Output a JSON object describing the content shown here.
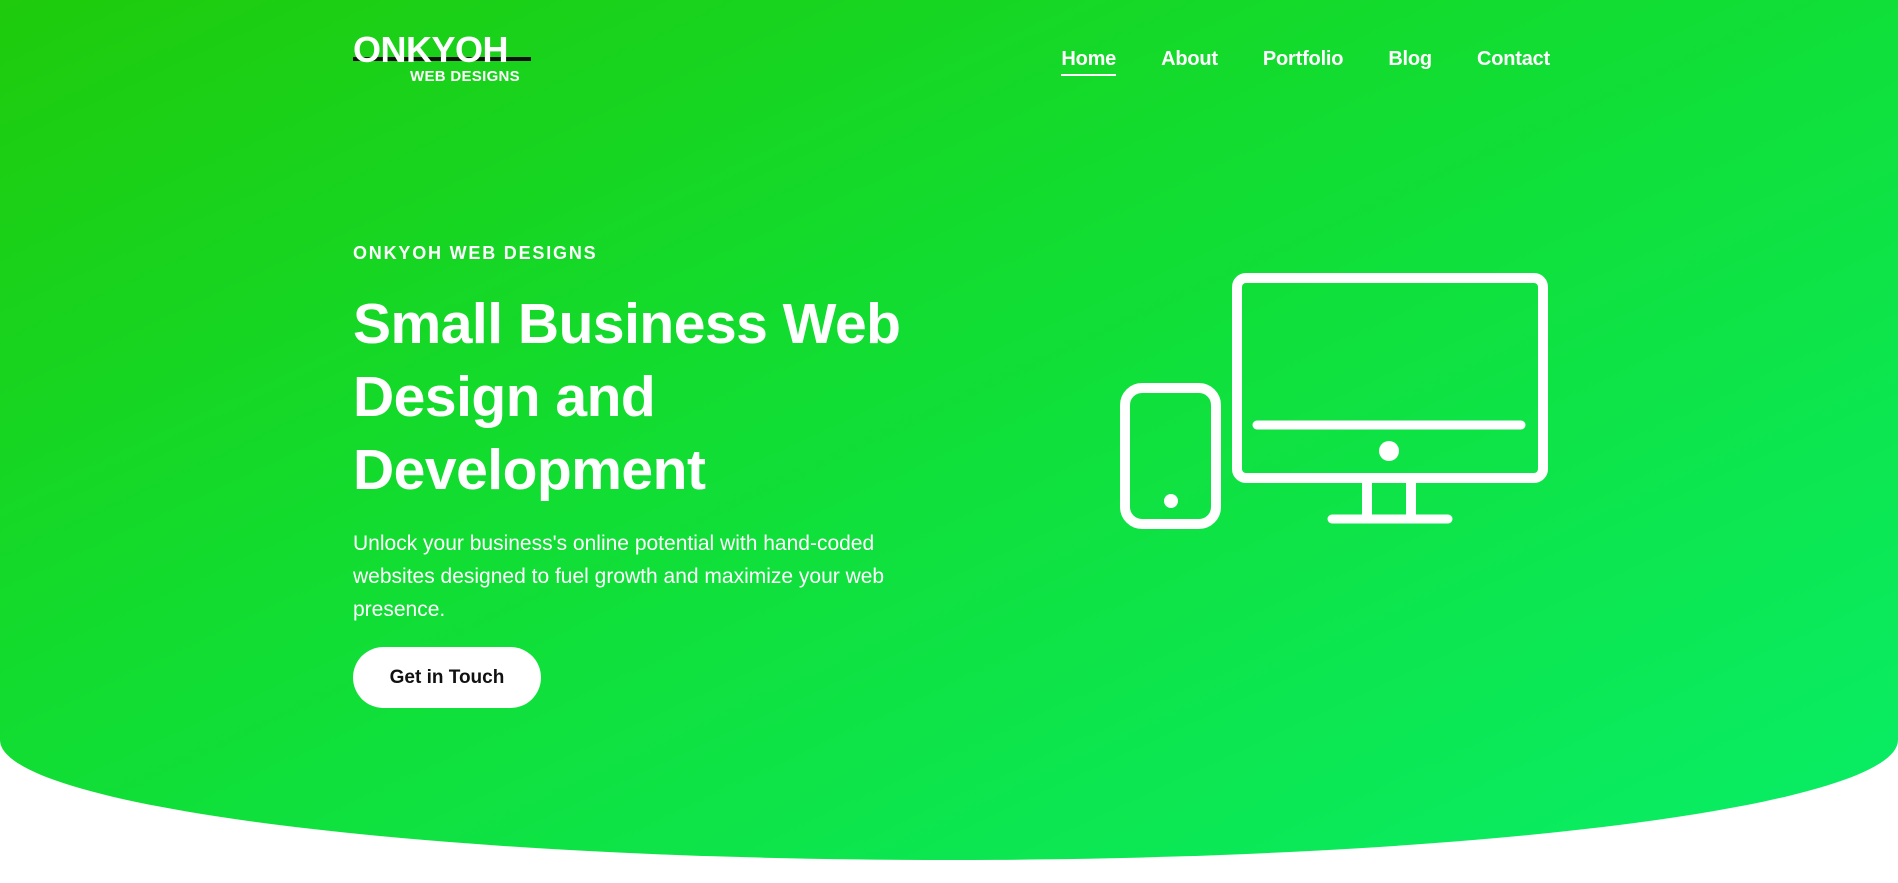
{
  "header": {
    "logo": {
      "main": "ONKYOH",
      "sub": "WEB DESIGNS"
    },
    "nav": [
      {
        "label": "Home",
        "active": true
      },
      {
        "label": "About",
        "active": false
      },
      {
        "label": "Portfolio",
        "active": false
      },
      {
        "label": "Blog",
        "active": false
      },
      {
        "label": "Contact",
        "active": false
      }
    ]
  },
  "hero": {
    "eyebrow": "ONKYOH WEB DESIGNS",
    "headline": "Small Business Web Design and Development",
    "lead": "Unlock your business's online potential with hand-coded websites designed to fuel growth and maximize your web presence.",
    "cta_label": "Get in Touch",
    "illustration_icon": "devices-icon"
  },
  "colors": {
    "gradient_start": "#1fcb0c",
    "gradient_end": "#08ee68",
    "text": "#ffffff",
    "button_bg": "#ffffff",
    "button_text": "#111111"
  }
}
